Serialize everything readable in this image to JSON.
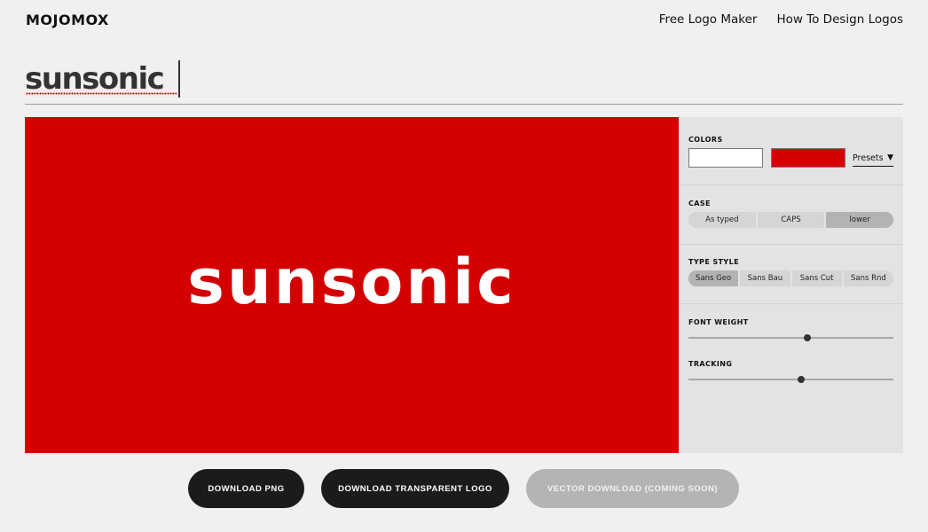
{
  "brand": "MOJOMOX",
  "nav": [
    "Free Logo Maker",
    "How To Design Logos"
  ],
  "name_input": {
    "value": "sunsonic"
  },
  "preview": {
    "text": "sunsonic",
    "background": "#d40000",
    "text_color": "#ffffff"
  },
  "controls": {
    "colors": {
      "label": "COLORS",
      "text_color": "#ffffff",
      "background_color": "#d40000",
      "presets_label": "Presets"
    },
    "case": {
      "label": "CASE",
      "options": [
        "As typed",
        "CAPS",
        "lower"
      ],
      "selected": "lower"
    },
    "type_style": {
      "label": "TYPE STYLE",
      "options": [
        "Sans Geo",
        "Sans Bau",
        "Sans Cut",
        "Sans Rnd"
      ],
      "selected": "Sans Geo"
    },
    "font_weight": {
      "label": "FONT WEIGHT",
      "value_fraction": 0.58
    },
    "tracking": {
      "label": "TRACKING",
      "value_fraction": 0.55
    }
  },
  "buttons": {
    "download_png": "DOWNLOAD PNG",
    "download_transparent": "DOWNLOAD TRANSPARENT LOGO",
    "vector_download": "VECTOR DOWNLOAD (COMING SOON)"
  }
}
